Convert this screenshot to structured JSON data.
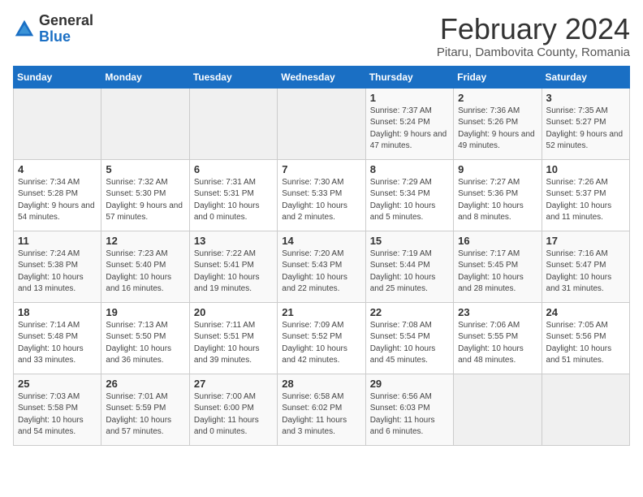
{
  "logo": {
    "general": "General",
    "blue": "Blue"
  },
  "calendar": {
    "title": "February 2024",
    "subtitle": "Pitaru, Dambovita County, Romania"
  },
  "weekdays": [
    "Sunday",
    "Monday",
    "Tuesday",
    "Wednesday",
    "Thursday",
    "Friday",
    "Saturday"
  ],
  "weeks": [
    [
      {
        "day": "",
        "info": ""
      },
      {
        "day": "",
        "info": ""
      },
      {
        "day": "",
        "info": ""
      },
      {
        "day": "",
        "info": ""
      },
      {
        "day": "1",
        "info": "Sunrise: 7:37 AM\nSunset: 5:24 PM\nDaylight: 9 hours and 47 minutes."
      },
      {
        "day": "2",
        "info": "Sunrise: 7:36 AM\nSunset: 5:26 PM\nDaylight: 9 hours and 49 minutes."
      },
      {
        "day": "3",
        "info": "Sunrise: 7:35 AM\nSunset: 5:27 PM\nDaylight: 9 hours and 52 minutes."
      }
    ],
    [
      {
        "day": "4",
        "info": "Sunrise: 7:34 AM\nSunset: 5:28 PM\nDaylight: 9 hours and 54 minutes."
      },
      {
        "day": "5",
        "info": "Sunrise: 7:32 AM\nSunset: 5:30 PM\nDaylight: 9 hours and 57 minutes."
      },
      {
        "day": "6",
        "info": "Sunrise: 7:31 AM\nSunset: 5:31 PM\nDaylight: 10 hours and 0 minutes."
      },
      {
        "day": "7",
        "info": "Sunrise: 7:30 AM\nSunset: 5:33 PM\nDaylight: 10 hours and 2 minutes."
      },
      {
        "day": "8",
        "info": "Sunrise: 7:29 AM\nSunset: 5:34 PM\nDaylight: 10 hours and 5 minutes."
      },
      {
        "day": "9",
        "info": "Sunrise: 7:27 AM\nSunset: 5:36 PM\nDaylight: 10 hours and 8 minutes."
      },
      {
        "day": "10",
        "info": "Sunrise: 7:26 AM\nSunset: 5:37 PM\nDaylight: 10 hours and 11 minutes."
      }
    ],
    [
      {
        "day": "11",
        "info": "Sunrise: 7:24 AM\nSunset: 5:38 PM\nDaylight: 10 hours and 13 minutes."
      },
      {
        "day": "12",
        "info": "Sunrise: 7:23 AM\nSunset: 5:40 PM\nDaylight: 10 hours and 16 minutes."
      },
      {
        "day": "13",
        "info": "Sunrise: 7:22 AM\nSunset: 5:41 PM\nDaylight: 10 hours and 19 minutes."
      },
      {
        "day": "14",
        "info": "Sunrise: 7:20 AM\nSunset: 5:43 PM\nDaylight: 10 hours and 22 minutes."
      },
      {
        "day": "15",
        "info": "Sunrise: 7:19 AM\nSunset: 5:44 PM\nDaylight: 10 hours and 25 minutes."
      },
      {
        "day": "16",
        "info": "Sunrise: 7:17 AM\nSunset: 5:45 PM\nDaylight: 10 hours and 28 minutes."
      },
      {
        "day": "17",
        "info": "Sunrise: 7:16 AM\nSunset: 5:47 PM\nDaylight: 10 hours and 31 minutes."
      }
    ],
    [
      {
        "day": "18",
        "info": "Sunrise: 7:14 AM\nSunset: 5:48 PM\nDaylight: 10 hours and 33 minutes."
      },
      {
        "day": "19",
        "info": "Sunrise: 7:13 AM\nSunset: 5:50 PM\nDaylight: 10 hours and 36 minutes."
      },
      {
        "day": "20",
        "info": "Sunrise: 7:11 AM\nSunset: 5:51 PM\nDaylight: 10 hours and 39 minutes."
      },
      {
        "day": "21",
        "info": "Sunrise: 7:09 AM\nSunset: 5:52 PM\nDaylight: 10 hours and 42 minutes."
      },
      {
        "day": "22",
        "info": "Sunrise: 7:08 AM\nSunset: 5:54 PM\nDaylight: 10 hours and 45 minutes."
      },
      {
        "day": "23",
        "info": "Sunrise: 7:06 AM\nSunset: 5:55 PM\nDaylight: 10 hours and 48 minutes."
      },
      {
        "day": "24",
        "info": "Sunrise: 7:05 AM\nSunset: 5:56 PM\nDaylight: 10 hours and 51 minutes."
      }
    ],
    [
      {
        "day": "25",
        "info": "Sunrise: 7:03 AM\nSunset: 5:58 PM\nDaylight: 10 hours and 54 minutes."
      },
      {
        "day": "26",
        "info": "Sunrise: 7:01 AM\nSunset: 5:59 PM\nDaylight: 10 hours and 57 minutes."
      },
      {
        "day": "27",
        "info": "Sunrise: 7:00 AM\nSunset: 6:00 PM\nDaylight: 11 hours and 0 minutes."
      },
      {
        "day": "28",
        "info": "Sunrise: 6:58 AM\nSunset: 6:02 PM\nDaylight: 11 hours and 3 minutes."
      },
      {
        "day": "29",
        "info": "Sunrise: 6:56 AM\nSunset: 6:03 PM\nDaylight: 11 hours and 6 minutes."
      },
      {
        "day": "",
        "info": ""
      },
      {
        "day": "",
        "info": ""
      }
    ]
  ]
}
